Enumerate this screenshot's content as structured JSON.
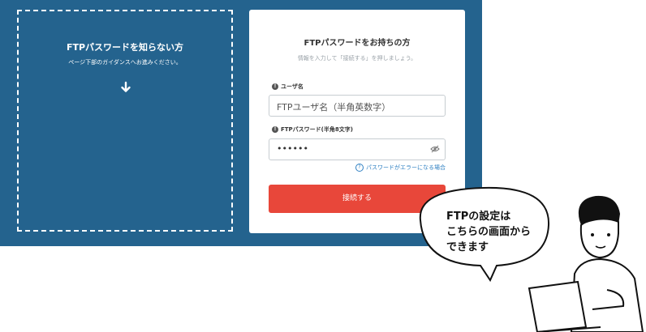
{
  "left_panel": {
    "title": "FTPパスワードを知らない方",
    "description": "ページ下部のガイダンスへお進みください。",
    "arrow_icon": "arrow-down-icon"
  },
  "login_card": {
    "title": "FTPパスワードをお持ちの方",
    "subtitle": "情報を入力して「接続する」を押しましょう。",
    "username_label": "ユーザ名",
    "username_placeholder": "FTPユーザ名（半角英数字）",
    "password_label": "FTPパスワード(半角8文字)",
    "password_value": "••••••",
    "help_link": "パスワードがエラーになる場合",
    "connect_button": "接続する"
  },
  "speech_bubble": {
    "line1": "FTPの設定は",
    "line2": "こちらの画面から",
    "line3": "できます"
  },
  "colors": {
    "panel_blue": "#24638e",
    "button_red": "#e8473a",
    "link_blue": "#2f80c2"
  }
}
